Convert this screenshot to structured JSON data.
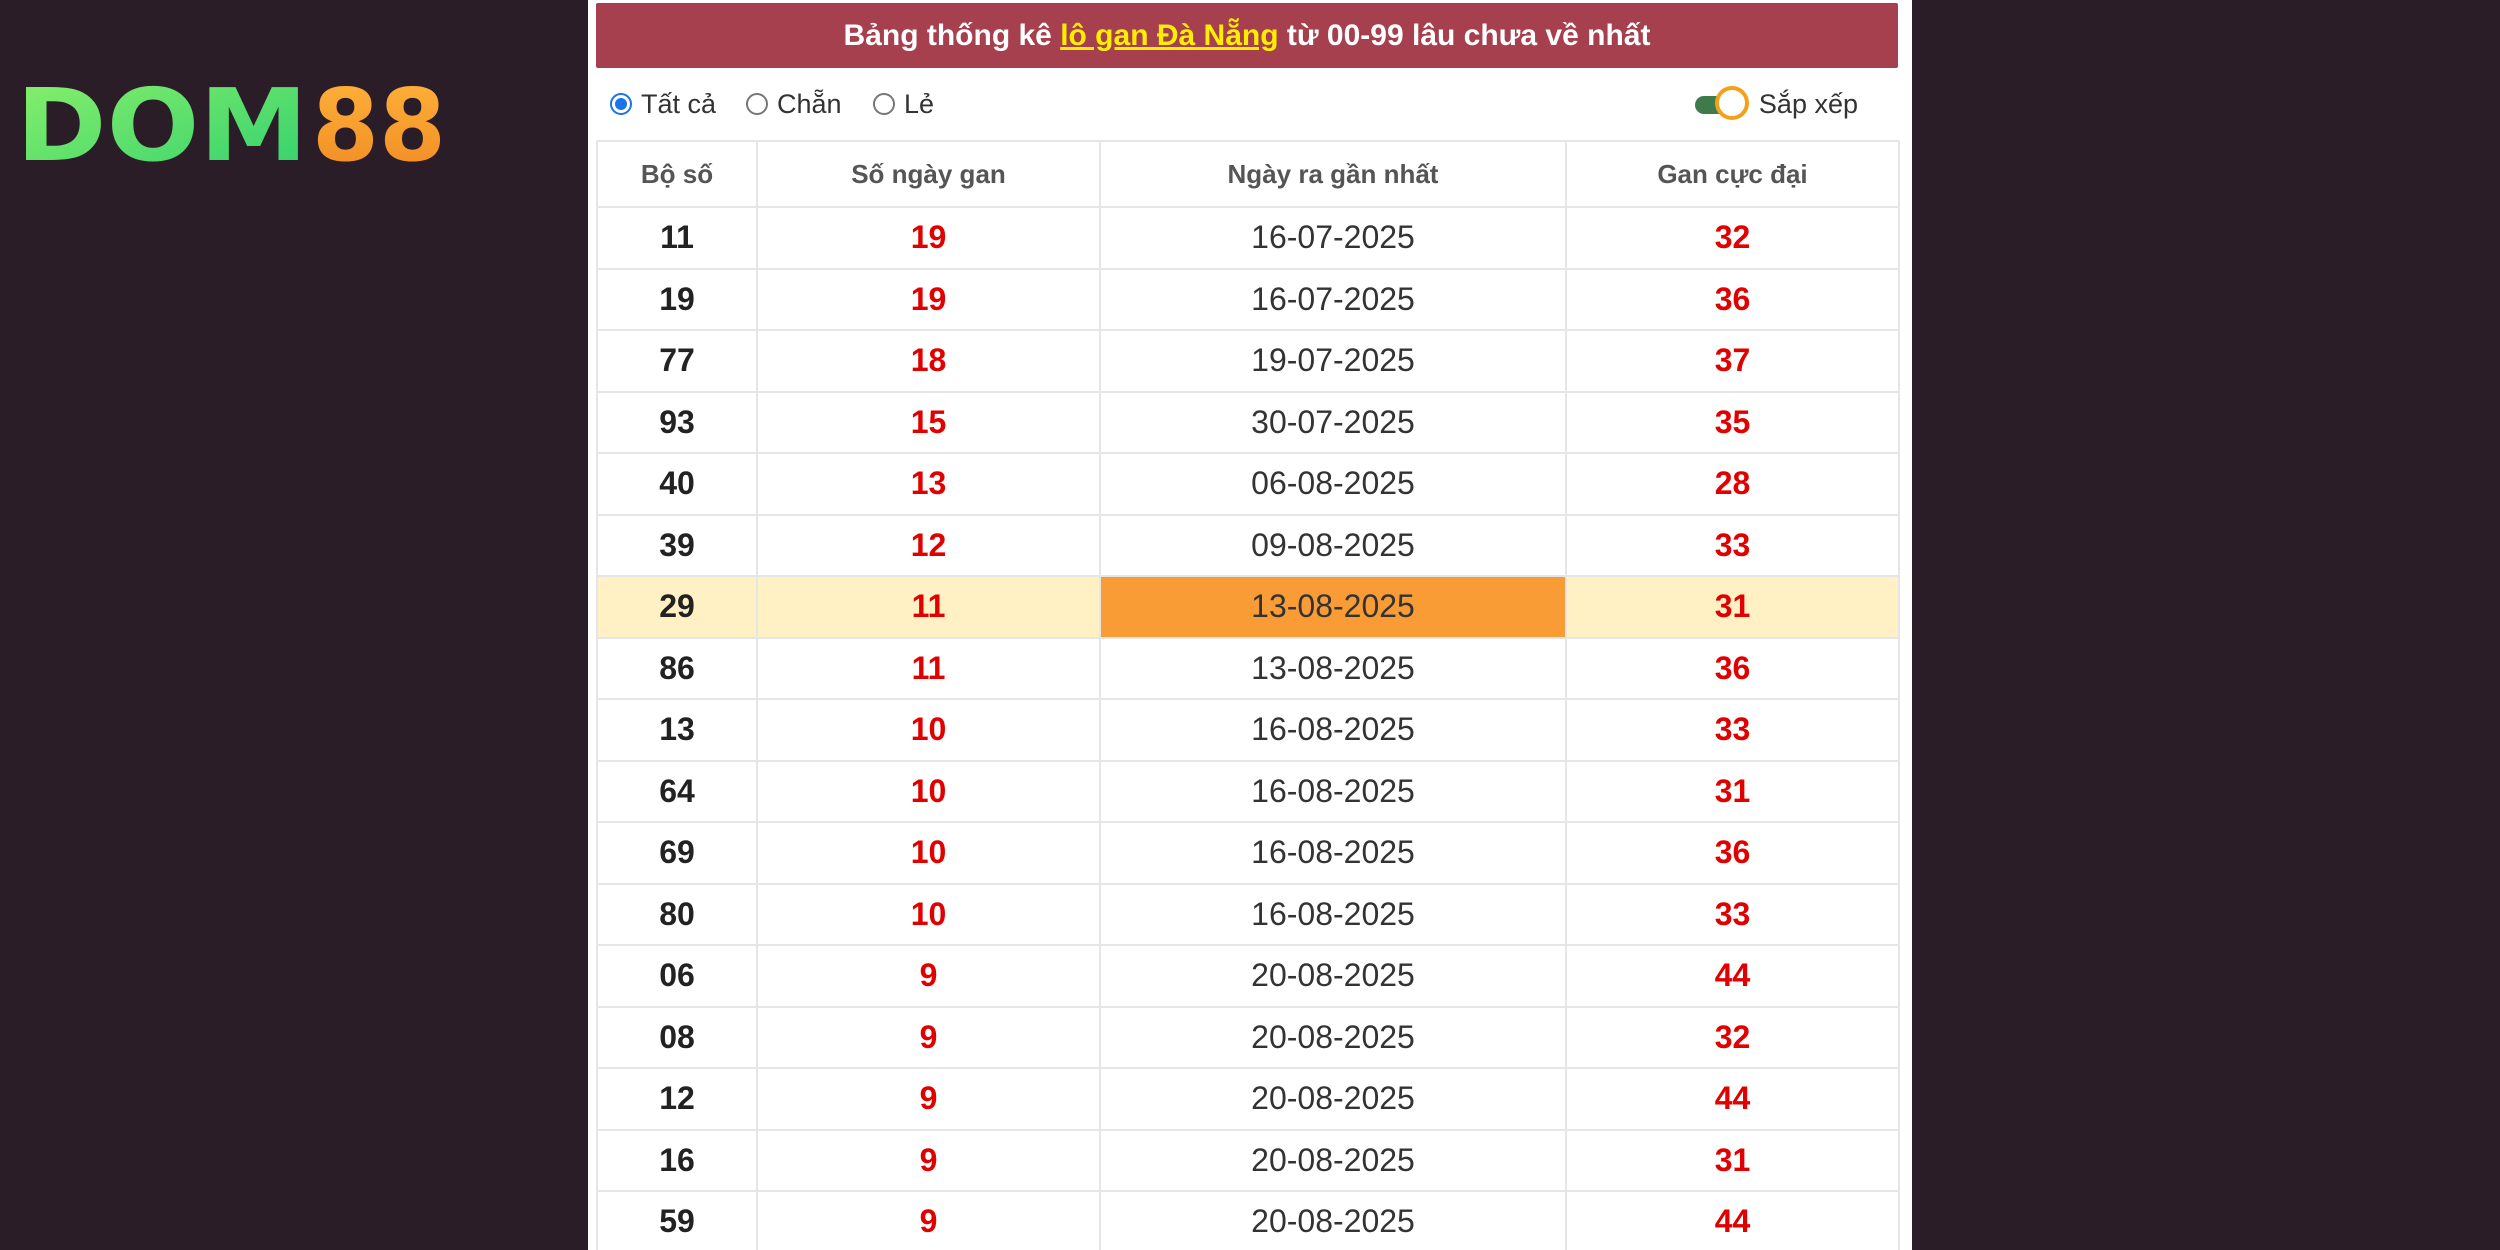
{
  "logo": {
    "text_left": "DOM",
    "text_right": "88",
    "color_left": "#4fe07a",
    "color_right": "#f7a132"
  },
  "header": {
    "prefix": "Bảng thống kê ",
    "highlight": "lô gan Đà Nẵng",
    "suffix": " từ 00-99 lâu chưa về nhất",
    "background": "#a63f4e",
    "highlight_color": "#ffee00"
  },
  "filters": {
    "options": [
      {
        "label": "Tất cả",
        "checked": true
      },
      {
        "label": "Chẵn",
        "checked": false
      },
      {
        "label": "Lẻ",
        "checked": false
      }
    ],
    "sort_label": "Sắp xếp",
    "sort_on": true
  },
  "table": {
    "headers": [
      "Bộ số",
      "Số ngày gan",
      "Ngày ra gần nhất",
      "Gan cực đại"
    ],
    "highlight_row": 6,
    "rows": [
      [
        "11",
        "19",
        "16-07-2025",
        "32"
      ],
      [
        "19",
        "19",
        "16-07-2025",
        "36"
      ],
      [
        "77",
        "18",
        "19-07-2025",
        "37"
      ],
      [
        "93",
        "15",
        "30-07-2025",
        "35"
      ],
      [
        "40",
        "13",
        "06-08-2025",
        "28"
      ],
      [
        "39",
        "12",
        "09-08-2025",
        "33"
      ],
      [
        "29",
        "11",
        "13-08-2025",
        "31"
      ],
      [
        "86",
        "11",
        "13-08-2025",
        "36"
      ],
      [
        "13",
        "10",
        "16-08-2025",
        "33"
      ],
      [
        "64",
        "10",
        "16-08-2025",
        "31"
      ],
      [
        "69",
        "10",
        "16-08-2025",
        "36"
      ],
      [
        "80",
        "10",
        "16-08-2025",
        "33"
      ],
      [
        "06",
        "9",
        "20-08-2025",
        "44"
      ],
      [
        "08",
        "9",
        "20-08-2025",
        "32"
      ],
      [
        "12",
        "9",
        "20-08-2025",
        "44"
      ],
      [
        "16",
        "9",
        "20-08-2025",
        "31"
      ],
      [
        "59",
        "9",
        "20-08-2025",
        "44"
      ]
    ]
  }
}
